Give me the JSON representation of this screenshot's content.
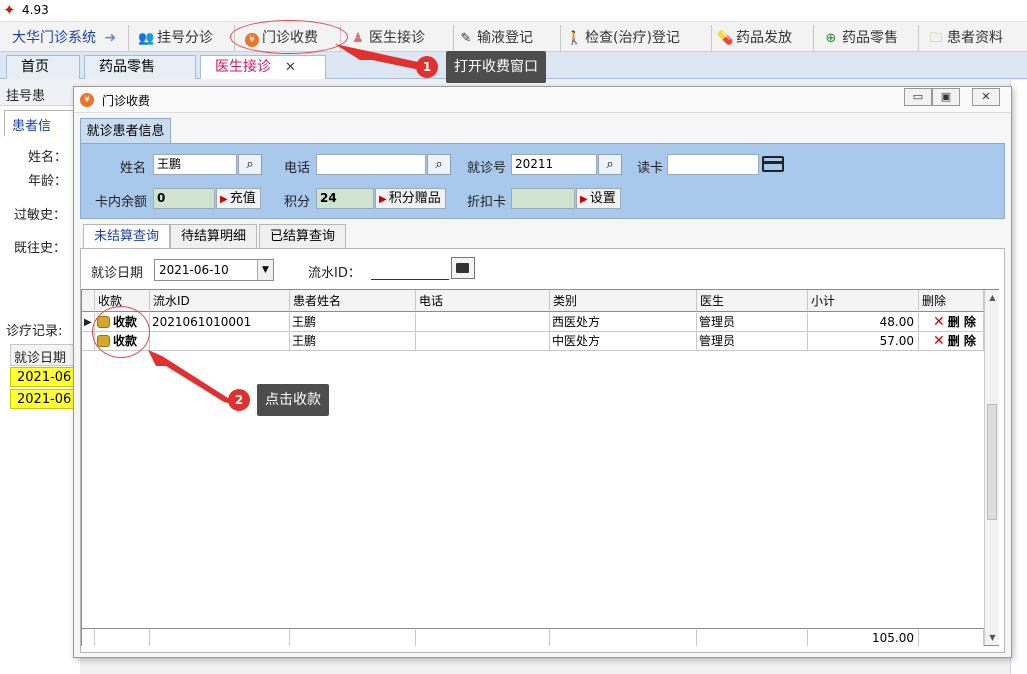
{
  "app": {
    "version": "4.93"
  },
  "topmenu": {
    "system": "大华门诊系统",
    "items": [
      "挂号分诊",
      "门诊收费",
      "医生接诊",
      "输液登记",
      "检查(治疗)登记",
      "药品发放",
      "药品零售",
      "患者资料"
    ]
  },
  "tabs": [
    "首页",
    "药品零售",
    "医生接诊"
  ],
  "background": {
    "header": "挂号患",
    "patient_tab": "患者信",
    "name_label": "姓名：",
    "age_label": "年龄：",
    "allergy_label": "过敏史：",
    "history_label": "既往史：",
    "records_label": "诊疗记录:",
    "date_header": "就诊日期",
    "row1": "2021-06",
    "row2": "2021-06"
  },
  "dialog": {
    "title": "门诊收费",
    "patient_section": "就诊患者信息",
    "fields": {
      "name_label": "姓名",
      "name_value": "王鹏",
      "phone_label": "电话",
      "phone_value": "",
      "visit_label": "就诊号",
      "visit_value": "20211",
      "readcard_label": "读卡",
      "readcard_value": "",
      "balance_label": "卡内余额",
      "balance_value": "0",
      "recharge_btn": "充值",
      "points_label": "积分",
      "points_value": "24",
      "gift_btn": "积分赠品",
      "discount_label": "折扣卡",
      "discount_value": "",
      "settings_btn": "设置"
    },
    "subtabs": [
      "未结算查询",
      "待结算明细",
      "已结算查询"
    ],
    "filter": {
      "date_label": "就诊日期",
      "date_value": "2021-06-10",
      "flow_label": "流水ID：",
      "flow_value": ""
    },
    "grid": {
      "headers": [
        "收款",
        "流水ID",
        "患者姓名",
        "电话",
        "类别",
        "医生",
        "小计",
        "删除"
      ],
      "rows": [
        {
          "pay": "收款",
          "flow_id": "2021061010001",
          "patient": "王鹏",
          "phone": "",
          "category": "西医处方",
          "doctor": "管理员",
          "subtotal": "48.00",
          "delete": "删 除"
        },
        {
          "pay": "收款",
          "flow_id": "",
          "patient": "王鹏",
          "phone": "",
          "category": "中医处方",
          "doctor": "管理员",
          "subtotal": "57.00",
          "delete": "删 除"
        }
      ],
      "total": "105.00"
    }
  },
  "annotations": {
    "step1_num": "1",
    "step1_text": "打开收费窗口",
    "step2_num": "2",
    "step2_text": "点击收款"
  },
  "colors": {
    "annotation_red": "#e03030",
    "tab_active": "#d3155f",
    "panel_blue": "#a8c8ec",
    "highlight_yellow": "#ffff33"
  }
}
